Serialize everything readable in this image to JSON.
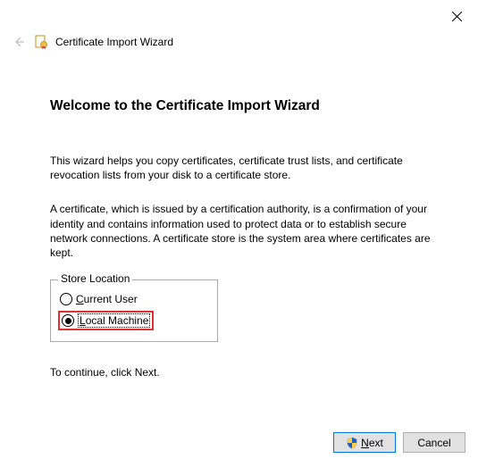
{
  "window": {
    "wizard_label": "Certificate Import Wizard"
  },
  "content": {
    "heading": "Welcome to the Certificate Import Wizard",
    "para1": "This wizard helps you copy certificates, certificate trust lists, and certificate revocation lists from your disk to a certificate store.",
    "para2": "A certificate, which is issued by a certification authority, is a confirmation of your identity and contains information used to protect data or to establish secure network connections. A certificate store is the system area where certificates are kept.",
    "store_location": {
      "legend": "Store Location",
      "current_user_letter": "C",
      "current_user_rest": "urrent User",
      "local_machine_letter": "L",
      "local_machine_rest": "ocal Machine"
    },
    "continue_text": "To continue, click Next."
  },
  "footer": {
    "next_letter": "N",
    "next_rest": "ext",
    "cancel_label": "Cancel"
  }
}
